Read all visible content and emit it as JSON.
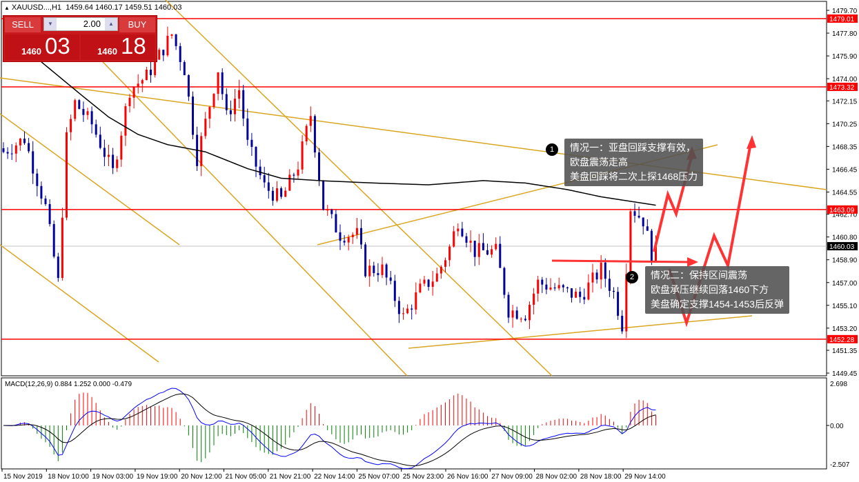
{
  "header": {
    "symbol": "XAUUSD...,H1",
    "open": "1459.64",
    "high": "1460.17",
    "low": "1459.51",
    "close": "1460.03"
  },
  "trade_panel": {
    "sell_label": "SELL",
    "buy_label": "BUY",
    "lot": "2.00",
    "sell_small": "1460",
    "sell_big": "03",
    "buy_small": "1460",
    "buy_big": "18"
  },
  "notes": [
    {
      "num": "1",
      "lines": [
        "情况一：亚盘回踩支撑有效，",
        "欧盘震荡走高",
        "美盘回踩将二次上探1468压力"
      ]
    },
    {
      "num": "2",
      "lines": [
        "情况二：保持区间震荡",
        "欧盘承压继续回落1460下方",
        "美盘确定支撑1454-1453后反弹"
      ]
    }
  ],
  "colors": {
    "up": "#ff0000",
    "down": "#00009c",
    "level": "#ff0000",
    "trend": "#daa520",
    "ma": "#000000",
    "macd_pos": "#ff0000",
    "macd_neg": "#008000",
    "macd_line": "#0000ff",
    "signal": "#000000"
  },
  "chart_data": {
    "type": "candlestick",
    "price_axis": {
      "min": 1449.45,
      "max": 1479.7,
      "ticks": [
        "1479.70",
        "1477.80",
        "1475.90",
        "1474.00",
        "1472.15",
        "1470.25",
        "1468.35",
        "1466.45",
        "1464.55",
        "1462.70",
        "1460.80",
        "1458.90",
        "1457.00",
        "1455.10",
        "1453.20",
        "1451.35",
        "1449.45"
      ]
    },
    "levels": [
      {
        "value": 1479.01,
        "label": "1479.01"
      },
      {
        "value": 1473.32,
        "label": "1473.32"
      },
      {
        "value": 1463.09,
        "label": "1463.09"
      },
      {
        "value": 1452.28,
        "label": "1452.28"
      }
    ],
    "current_price": {
      "value": 1460.03,
      "label": "1460.03"
    },
    "bars": 156,
    "close_path": [
      [
        0,
        1467.9
      ],
      [
        5,
        1469
      ],
      [
        10,
        1463.3
      ],
      [
        13,
        1457
      ],
      [
        15,
        1469
      ],
      [
        17,
        1472
      ],
      [
        21,
        1470.2
      ],
      [
        26,
        1466.2
      ],
      [
        30,
        1473.1
      ],
      [
        34,
        1474.2
      ],
      [
        40,
        1477.7
      ],
      [
        43,
        1474.8
      ],
      [
        46,
        1467.4
      ],
      [
        51,
        1474.8
      ],
      [
        53,
        1470.8
      ],
      [
        56,
        1473.1
      ],
      [
        58,
        1468.5
      ],
      [
        62,
        1465
      ],
      [
        66,
        1463.9
      ],
      [
        70,
        1466.8
      ],
      [
        73,
        1471
      ],
      [
        76,
        1463.3
      ],
      [
        80,
        1461
      ],
      [
        84,
        1461
      ],
      [
        86,
        1458.1
      ],
      [
        90,
        1458.1
      ],
      [
        95,
        1454.1
      ],
      [
        99,
        1456.4
      ],
      [
        103,
        1457.6
      ],
      [
        106,
        1459.9
      ],
      [
        108,
        1462.2
      ],
      [
        112,
        1459.6
      ],
      [
        117,
        1459.6
      ],
      [
        120,
        1454.7
      ],
      [
        124,
        1454.4
      ],
      [
        127,
        1457
      ],
      [
        132,
        1456.4
      ],
      [
        137,
        1455.8
      ],
      [
        142,
        1458.1
      ],
      [
        145,
        1456.1
      ],
      [
        147,
        1453.5
      ],
      [
        149,
        1463.3
      ],
      [
        152,
        1462.2
      ],
      [
        154,
        1459.4
      ],
      [
        155,
        1460.03
      ]
    ],
    "ma_path": [
      [
        9,
        1475.4
      ],
      [
        19,
        1472.5
      ],
      [
        25,
        1470.8
      ],
      [
        32,
        1469.35
      ],
      [
        39,
        1468.5
      ],
      [
        48,
        1467.9
      ],
      [
        58,
        1466.5
      ],
      [
        66,
        1465.7
      ],
      [
        75,
        1465.5
      ],
      [
        88,
        1465.3
      ],
      [
        101,
        1465.15
      ],
      [
        114,
        1465.5
      ],
      [
        124,
        1465.3
      ],
      [
        134,
        1464.75
      ],
      [
        142,
        1464.15
      ],
      [
        155,
        1463.45
      ]
    ],
    "macd": {
      "label": "MACD(12,26,9) 0.884 1.252 0.000 -0.479",
      "max": "2.698",
      "zero": "0.00",
      "min": "-2.507"
    },
    "time_labels": [
      "15 Nov 2019",
      "18 Nov 10:00",
      "19 Nov 03:00",
      "19 Nov 19:00",
      "20 Nov 12:00",
      "21 Nov 05:00",
      "21 Nov 21:00",
      "22 Nov 14:00",
      "25 Nov 07:00",
      "25 Nov 23:00",
      "26 Nov 16:00",
      "27 Nov 09:00",
      "28 Nov 02:00",
      "28 Nov 18:00",
      "29 Nov 14:00"
    ]
  }
}
